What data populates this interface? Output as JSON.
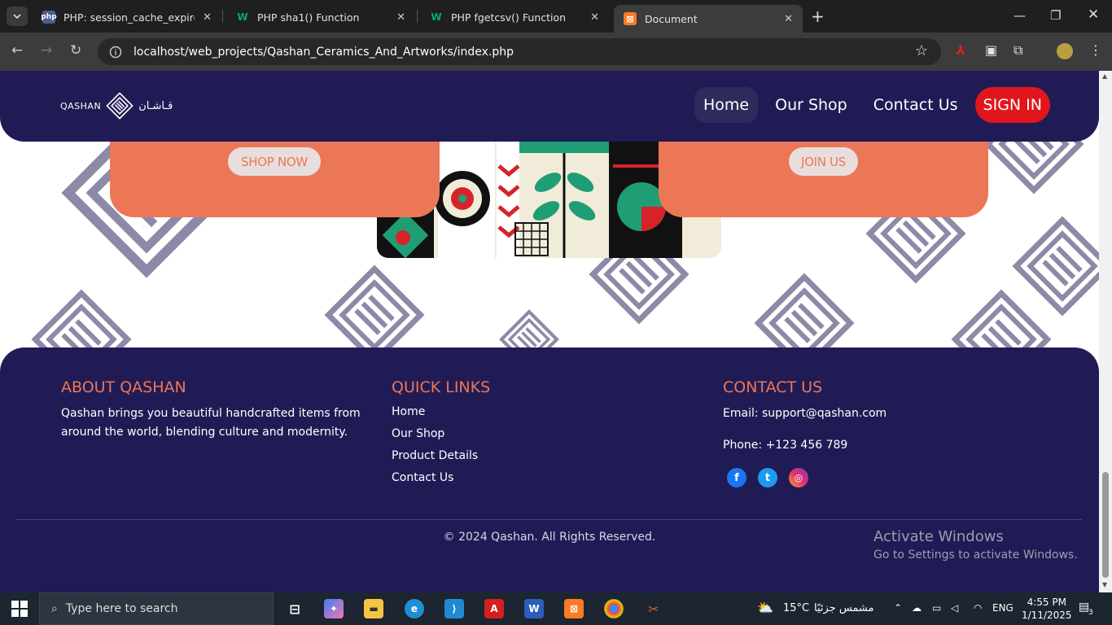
{
  "browser": {
    "tabs": [
      {
        "title": "PHP: session_cache_expire - Ma",
        "favicon": "php-icon",
        "favicon_text": "php",
        "active": false
      },
      {
        "title": "PHP sha1() Function",
        "favicon": "w3-icon",
        "favicon_text": "W",
        "active": false
      },
      {
        "title": "PHP fgetcsv() Function",
        "favicon": "w3-icon",
        "favicon_text": "W",
        "active": false
      },
      {
        "title": "Document",
        "favicon": "xampp-icon",
        "favicon_text": "⊠",
        "active": true
      }
    ],
    "url": "localhost/web_projects/Qashan_Ceramics_And_Artworks/index.php"
  },
  "header": {
    "logo_text": "QASHAN",
    "logo_arabic": "قـاشـان",
    "nav": [
      {
        "label": "Home",
        "active": true
      },
      {
        "label": "Our Shop",
        "active": false
      },
      {
        "label": "Contact Us",
        "active": false
      }
    ],
    "signin_label": "SIGN IN"
  },
  "cards": {
    "shop_now": "SHOP NOW",
    "join_us": "JOIN US"
  },
  "footer": {
    "about": {
      "heading": "ABOUT QASHAN",
      "text": "Qashan brings you beautiful handcrafted items from around the world, blending culture and modernity."
    },
    "quick_links": {
      "heading": "QUICK LINKS",
      "links": [
        "Home",
        "Our Shop",
        "Product Details",
        "Contact Us"
      ]
    },
    "contact": {
      "heading": "CONTACT US",
      "email": "Email: support@qashan.com",
      "phone": "Phone: +123 456 789",
      "social": [
        "facebook-icon",
        "twitter-icon",
        "instagram-icon"
      ]
    },
    "copyright": "© 2024 Qashan. All Rights Reserved."
  },
  "watermark": {
    "line1": "Activate Windows",
    "line2": "Go to Settings to activate Windows."
  },
  "taskbar": {
    "search_placeholder": "Type here to search",
    "weather_temp": "15°C",
    "weather_text": "مشمس جزئيًا",
    "language": "ENG",
    "time": "4:55 PM",
    "date": "1/11/2025",
    "notification_count": "3"
  },
  "colors": {
    "navy": "#211b55",
    "coral": "#ec7756",
    "signin_red": "#e0161c"
  }
}
